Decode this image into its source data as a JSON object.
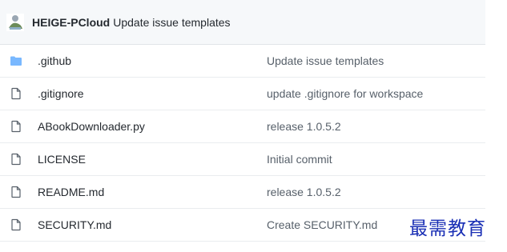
{
  "commit": {
    "author": "HEIGE-PCloud",
    "message": "Update issue templates"
  },
  "files": [
    {
      "name": ".github",
      "type": "folder",
      "icon": "folder-icon",
      "commit": "Update issue templates"
    },
    {
      "name": ".gitignore",
      "type": "file",
      "icon": "file-icon",
      "commit": "update .gitignore for workspace"
    },
    {
      "name": "ABookDownloader.py",
      "type": "file",
      "icon": "file-icon",
      "commit": "release 1.0.5.2"
    },
    {
      "name": "LICENSE",
      "type": "file",
      "icon": "file-icon",
      "commit": "Initial commit"
    },
    {
      "name": "README.md",
      "type": "file",
      "icon": "file-icon",
      "commit": "release 1.0.5.2"
    },
    {
      "name": "SECURITY.md",
      "type": "file",
      "icon": "file-icon",
      "commit": "Create SECURITY.md"
    }
  ],
  "watermark": "最需教育",
  "colors": {
    "folder": "#79b8ff",
    "file_icon": "#57606a",
    "header_bg": "#f6f8fa",
    "watermark": "#1a2fb5"
  }
}
